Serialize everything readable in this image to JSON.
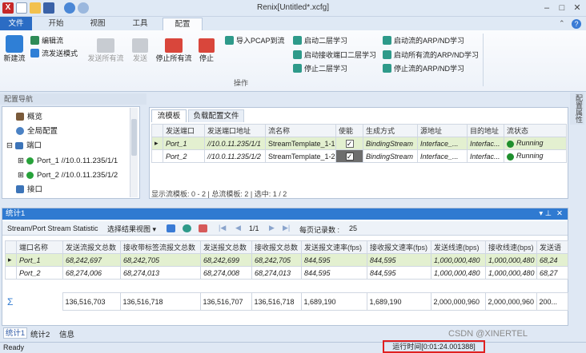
{
  "window": {
    "title": "Renix[Untitled*.xcfg]"
  },
  "menu_tabs": [
    {
      "label": "文件"
    },
    {
      "label": "开始"
    },
    {
      "label": "视图"
    },
    {
      "label": "工具"
    },
    {
      "label": "配置"
    }
  ],
  "ribbon": {
    "new_stream": "新建流",
    "edit_stream": "编辑流",
    "send_mode": "流发送模式",
    "send_all": "发送所有流",
    "send": "发送",
    "stop_all": "停止所有流",
    "stop": "停止",
    "import_pcap": "导入PCAP到流",
    "start_l2": "启动二层学习",
    "start_rx_l2": "启动接收端口二层学习",
    "stop_l2": "停止二层学习",
    "start_arp": "启动流的ARP/ND学习",
    "start_all_arp": "启动所有流的ARP/ND学习",
    "stop_arp": "停止流的ARP/ND学习",
    "group_label": "操作"
  },
  "config_nav": {
    "title": "配置导航",
    "items": [
      {
        "label": "概览"
      },
      {
        "label": "全局配置"
      },
      {
        "label": "端口"
      },
      {
        "label": "Port_1 //10.0.11.235/1/1"
      },
      {
        "label": "Port_2 //10.0.11.235/1/2"
      },
      {
        "label": "接口"
      }
    ]
  },
  "stream_panel": {
    "tabs": [
      {
        "label": "流模板"
      },
      {
        "label": "负载配置文件"
      }
    ],
    "columns": [
      "发送端口",
      "发送端口地址",
      "流名称",
      "使能",
      "生成方式",
      "源地址",
      "目的地址",
      "流状态"
    ],
    "rows": [
      {
        "port": "Port_1",
        "addr": "//10.0.11.235/1/1",
        "name": "StreamTemplate_1-1",
        "mode": "BindingStream",
        "src": "Interface_...",
        "dst": "Interfac...",
        "status": "Running"
      },
      {
        "port": "Port_2",
        "addr": "//10.0.11.235/1/2",
        "name": "StreamTemplate_1-2",
        "mode": "BindingStream",
        "src": "Interface_...",
        "dst": "Interfac...",
        "status": "Running"
      }
    ],
    "summary": "显示流模板: 0 - 2 | 总流模板: 2 | 选中: 1 / 2"
  },
  "side_tab": "配置属性",
  "stats": {
    "title": "统计1",
    "view_name": "Stream/Port Stream Statistic",
    "select_view": "选择结果视图",
    "page": "1/1",
    "per_page_label": "每页记录数 :",
    "per_page": "25",
    "columns": [
      "端口名称",
      "发送流报文总数",
      "接收带标签流报文总数",
      "发送报文总数",
      "接收报文总数",
      "发送报文速率(fps)",
      "接收报文速率(fps)",
      "发送线速(bps)",
      "接收线速(bps)",
      "发送语"
    ],
    "rows": [
      [
        "Port_1",
        "68,242,697",
        "68,242,705",
        "68,242,699",
        "68,242,705",
        "844,595",
        "844,595",
        "1,000,000,480",
        "1,000,000,480",
        "68,24"
      ],
      [
        "Port_2",
        "68,274,006",
        "68,274,013",
        "68,274,008",
        "68,274,013",
        "844,595",
        "844,595",
        "1,000,000,480",
        "1,000,000,480",
        "68,27"
      ]
    ],
    "totals": [
      "136,516,703",
      "136,516,718",
      "136,516,707",
      "136,516,718",
      "1,689,190",
      "1,689,190",
      "2,000,000,960",
      "2,000,000,960",
      "200..."
    ]
  },
  "bottom_tabs": [
    {
      "label": "统计1"
    },
    {
      "label": "统计2"
    },
    {
      "label": "信息"
    }
  ],
  "status": {
    "ready": "Ready",
    "runtime": "运行时间[0:01:24.001388]",
    "watermark": "CSDN @XINERTEL"
  },
  "colors": {
    "accent": "#2b6cc4",
    "running": "#1f8f2e",
    "highlight_border": "#e02020"
  }
}
